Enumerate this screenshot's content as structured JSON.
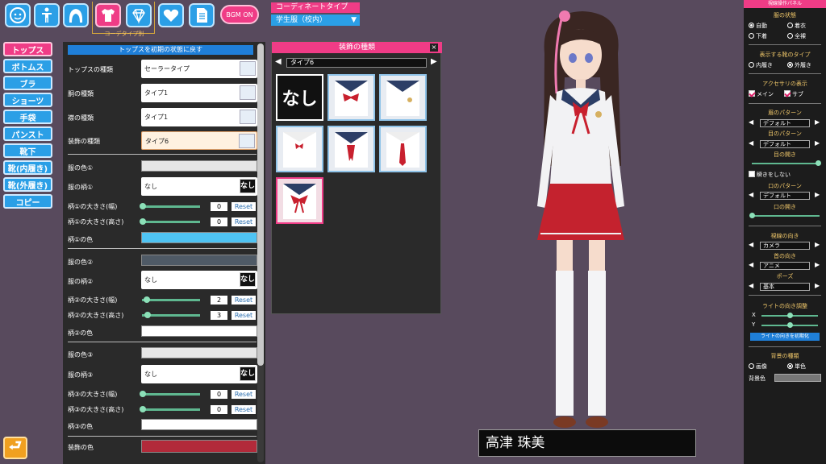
{
  "top_icons": [
    {
      "name": "face-icon"
    },
    {
      "name": "body-icon"
    },
    {
      "name": "hair-icon"
    },
    {
      "name": "clothing-icon",
      "active": true
    },
    {
      "name": "accessory-icon"
    },
    {
      "name": "heart-icon"
    },
    {
      "name": "document-icon"
    }
  ],
  "category_caption": "コーデタイプ別",
  "bgm_label": "BGM ON",
  "tabs": [
    "トップス",
    "ボトムス",
    "ブラ",
    "ショーツ",
    "手袋",
    "パンスト",
    "靴下",
    "靴(内履き)",
    "靴(外履き)",
    "コピー"
  ],
  "panel": {
    "reset_label": "トップスを初期の状態に戻す",
    "rows": {
      "tops_type": {
        "label": "トップスの種類",
        "value": "セーラータイプ"
      },
      "body_type": {
        "label": "胴の種類",
        "value": "タイプ1"
      },
      "collar_type": {
        "label": "襟の種類",
        "value": "タイプ1"
      },
      "deco_type": {
        "label": "装飾の種類",
        "value": "タイプ6"
      },
      "color1": {
        "label": "服の色①"
      },
      "pattern1": {
        "label": "服の柄①",
        "value": "なし",
        "badge": "なし"
      },
      "pw1": {
        "label": "柄①の大きさ(幅)",
        "value": "0",
        "reset": "Reset"
      },
      "ph1": {
        "label": "柄①の大きさ(高さ)",
        "value": "0",
        "reset": "Reset"
      },
      "pcolor1": {
        "label": "柄①の色"
      },
      "color2": {
        "label": "服の色②"
      },
      "pattern2": {
        "label": "服の柄②",
        "value": "なし",
        "badge": "なし"
      },
      "pw2": {
        "label": "柄②の大きさ(幅)",
        "value": "2",
        "reset": "Reset"
      },
      "ph2": {
        "label": "柄②の大きさ(高さ)",
        "value": "3",
        "reset": "Reset"
      },
      "pcolor2": {
        "label": "柄②の色"
      },
      "color3": {
        "label": "服の色③"
      },
      "pattern3": {
        "label": "服の柄③",
        "value": "なし",
        "badge": "なし"
      },
      "pw3": {
        "label": "柄③の大きさ(幅)",
        "value": "0",
        "reset": "Reset"
      },
      "ph3": {
        "label": "柄③の大きさ(高さ)",
        "value": "0",
        "reset": "Reset"
      },
      "pcolor3": {
        "label": "柄③の色"
      },
      "decocolor": {
        "label": "装飾の色"
      }
    },
    "colors": {
      "color1": "#e6e6e6",
      "pcolor1": "#4fc4f4",
      "color2": "#4f5a66",
      "pcolor2": "#ffffff",
      "color3": "#e6e6e6",
      "pcolor3": "#ffffff",
      "decocolor": "#b22a3a"
    }
  },
  "coordinate": {
    "title": "コーディネートタイプ",
    "value": "学生服（校内）"
  },
  "deco_popup": {
    "title": "装飾の種類",
    "selected": "タイプ6",
    "none_label": "なし",
    "close": "×"
  },
  "character_name": "高津 珠美",
  "right_panel": {
    "header": "視線操作パネル",
    "clothes_state_title": "服の状態",
    "clothes_state": [
      "自動",
      "着衣",
      "下着",
      "全裸"
    ],
    "shoes_title": "表示する靴のタイプ",
    "shoes": [
      "内履き",
      "外履き"
    ],
    "acc_title": "アクセサリの表示",
    "acc": [
      "メイン",
      "サブ"
    ],
    "eyebrow_title": "眉のパターン",
    "eyebrow_value": "デフォルト",
    "eye_title": "目のパターン",
    "eye_value": "デフォルト",
    "eye_open_title": "目の開き",
    "blink_label": "瞬きをしない",
    "mouth_title": "口のパターン",
    "mouth_value": "デフォルト",
    "mouth_open_title": "口の開き",
    "gaze_title": "視線の向き",
    "gaze_value": "カメラ",
    "neck_title": "首の向き",
    "neck_value": "アニメ",
    "pose_title": "ポーズ",
    "pose_value": "基本",
    "light_title": "ライトの向き調整",
    "light_x": "X",
    "light_y": "Y",
    "light_reset": "ライトの向きを初期化",
    "bg_title": "背景の種類",
    "bg": [
      "画像",
      "単色"
    ],
    "bg_color_label": "背景色"
  }
}
